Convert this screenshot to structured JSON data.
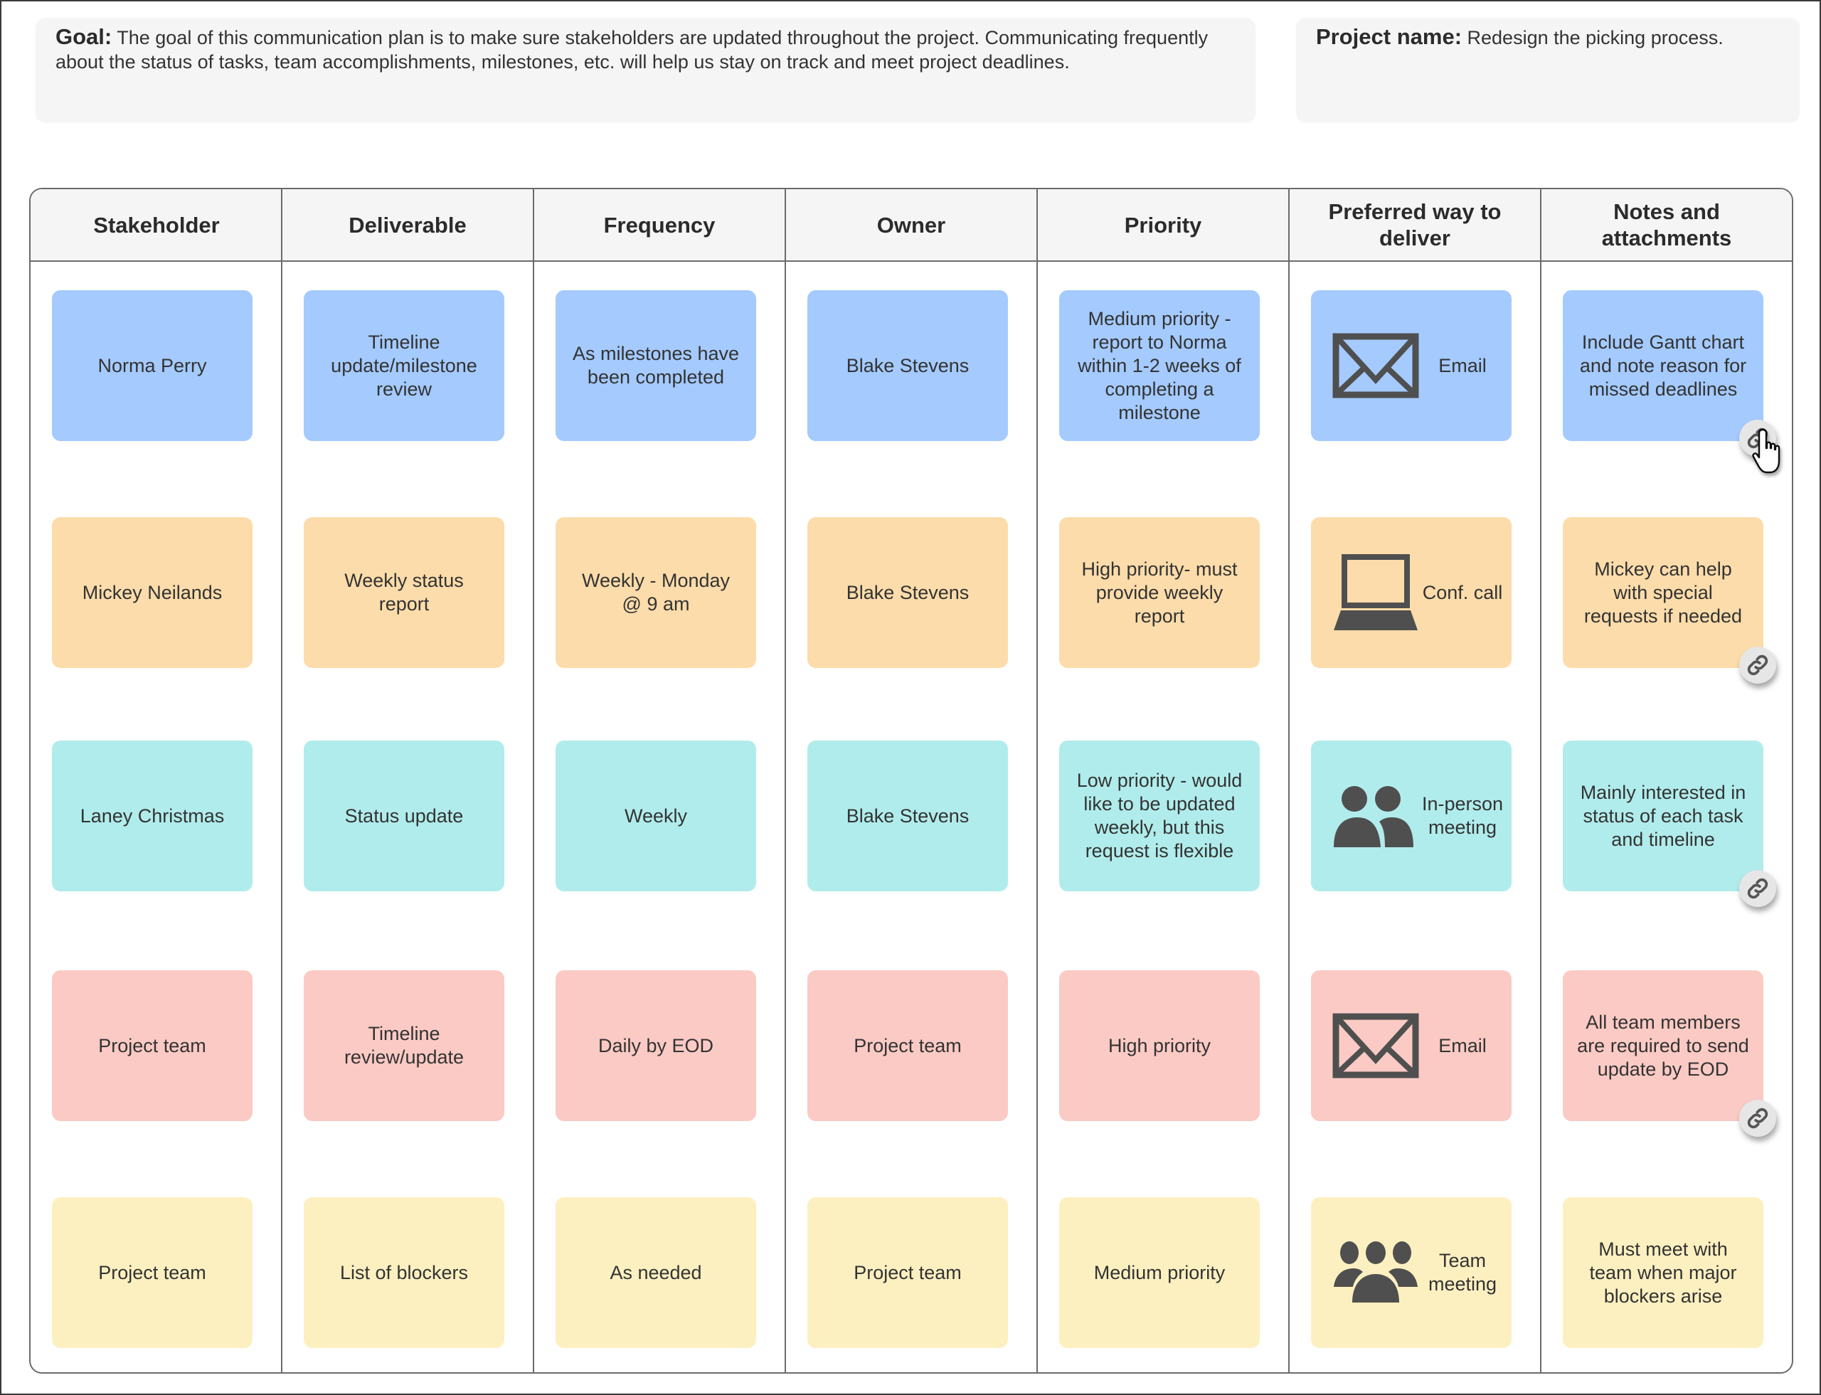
{
  "goal": {
    "label": "Goal:",
    "text": "The goal of this communication plan is to make sure stakeholders are updated throughout the project. Communicating frequently about the status of tasks, team accomplishments, milestones, etc. will help us stay on track and meet project deadlines."
  },
  "project": {
    "label": "Project name:",
    "text": "Redesign the picking process."
  },
  "colors": {
    "blue": "#a4cafe",
    "orange": "#fcdcaa",
    "teal": "#b1ecec",
    "pink": "#fbcac4",
    "yellow": "#fdf0c0",
    "icon": "#4f4f4f"
  },
  "table": {
    "headers": [
      "Stakeholder",
      "Deliverable",
      "Frequency",
      "Owner",
      "Priority",
      "Preferred way to deliver",
      "Notes and attachments"
    ],
    "rows": [
      {
        "color": "blue",
        "stakeholder": "Norma Perry",
        "deliverable": "Timeline update/milestone review",
        "frequency": "As milestones have been completed",
        "owner": "Blake Stevens",
        "priority": "Medium priority - report to Norma within 1-2 weeks of completing a milestone",
        "method": {
          "icon": "envelope-icon",
          "label": "Email"
        },
        "notes": "Include Gantt chart and note reason for missed deadlines",
        "has_link": true
      },
      {
        "color": "orange",
        "stakeholder": "Mickey Neilands",
        "deliverable": "Weekly status report",
        "frequency": "Weekly - Monday @ 9 am",
        "owner": "Blake Stevens",
        "priority": "High priority- must provide weekly report",
        "method": {
          "icon": "laptop-icon",
          "label": "Conf. call"
        },
        "notes": "Mickey can help with special requests if needed",
        "has_link": true
      },
      {
        "color": "teal",
        "stakeholder": "Laney Christmas",
        "deliverable": "Status update",
        "frequency": "Weekly",
        "owner": "Blake Stevens",
        "priority": "Low priority - would like to be updated weekly, but this request is flexible",
        "method": {
          "icon": "two-people-icon",
          "label": "In-person meeting"
        },
        "notes": "Mainly interested in status of each task and timeline",
        "has_link": true
      },
      {
        "color": "pink",
        "stakeholder": "Project team",
        "deliverable": "Timeline review/update",
        "frequency": "Daily by EOD",
        "owner": "Project team",
        "priority": "High priority",
        "method": {
          "icon": "envelope-icon",
          "label": "Email"
        },
        "notes": "All team members are required to send update by EOD",
        "has_link": true
      },
      {
        "color": "yellow",
        "stakeholder": "Project team",
        "deliverable": "List of blockers",
        "frequency": "As needed",
        "owner": "Project team",
        "priority": "Medium priority",
        "method": {
          "icon": "group-icon",
          "label": "Team meeting"
        },
        "notes": "Must meet with team when major blockers arise",
        "has_link": false
      }
    ]
  }
}
